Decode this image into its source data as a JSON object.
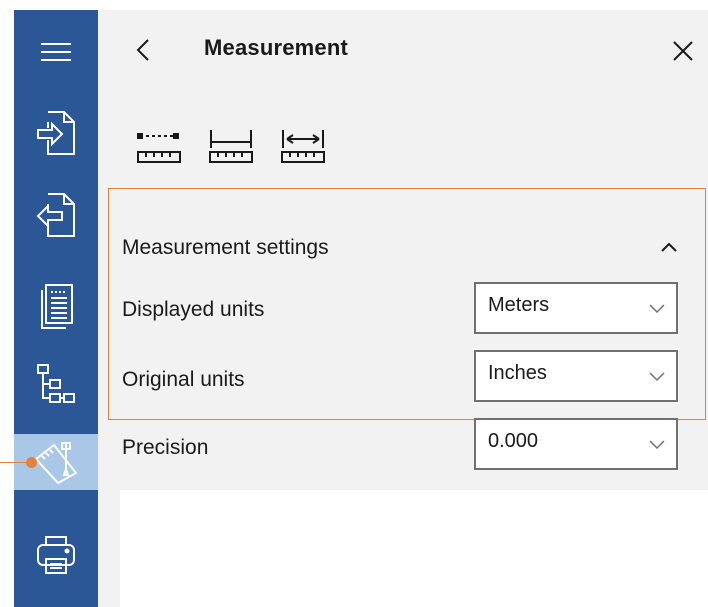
{
  "rail": {
    "items": [
      {
        "name": "menu",
        "icon": "hamburger-menu-icon"
      },
      {
        "name": "import",
        "icon": "import-file-icon"
      },
      {
        "name": "export",
        "icon": "export-file-icon"
      },
      {
        "name": "pages",
        "icon": "document-pages-icon"
      },
      {
        "name": "structure",
        "icon": "tree-structure-icon"
      },
      {
        "name": "measurement",
        "icon": "measurement-tool-icon",
        "active": true
      },
      {
        "name": "print",
        "icon": "printer-icon"
      }
    ],
    "colors": {
      "background": "#2b5797",
      "active": "#a9c7e6",
      "accent": "#e8803a"
    }
  },
  "panel": {
    "title": "Measurement",
    "tools": [
      {
        "icon": "distance-ruler-icon"
      },
      {
        "icon": "perimeter-ruler-icon"
      },
      {
        "icon": "area-ruler-icon"
      }
    ],
    "settings": {
      "section_title": "Measurement settings",
      "rows": [
        {
          "label": "Displayed units",
          "value": "Meters"
        },
        {
          "label": "Original units",
          "value": "Inches"
        },
        {
          "label": "Precision",
          "value": "0.000"
        }
      ]
    }
  }
}
